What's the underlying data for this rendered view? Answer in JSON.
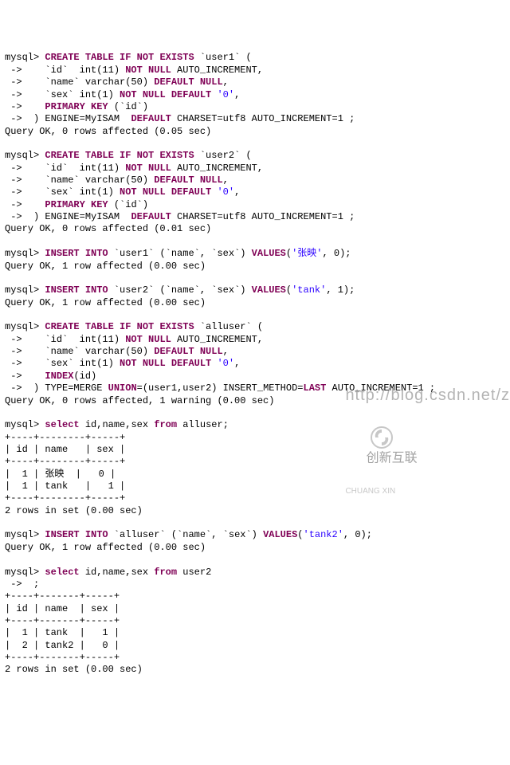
{
  "lines": [
    [
      {
        "t": "mysql> "
      },
      {
        "t": "CREATE TABLE IF NOT EXISTS",
        "cls": "kw"
      },
      {
        "t": " `user1` ("
      }
    ],
    [
      {
        "t": " -> "
      },
      {
        "t": "   `id`  int(11) "
      },
      {
        "t": "NOT NULL",
        "cls": "kw"
      },
      {
        "t": " AUTO_INCREMENT,"
      }
    ],
    [
      {
        "t": " -> "
      },
      {
        "t": "   `name` varchar(50) "
      },
      {
        "t": "DEFAULT NULL",
        "cls": "kw"
      },
      {
        "t": ","
      }
    ],
    [
      {
        "t": " -> "
      },
      {
        "t": "   `sex` int(1) "
      },
      {
        "t": "NOT NULL DEFAULT",
        "cls": "kw"
      },
      {
        "t": " "
      },
      {
        "t": "'0'",
        "cls": "str"
      },
      {
        "t": ","
      }
    ],
    [
      {
        "t": " -> "
      },
      {
        "t": "   "
      },
      {
        "t": "PRIMARY KEY",
        "cls": "kw"
      },
      {
        "t": " (`id`)"
      }
    ],
    [
      {
        "t": " -> "
      },
      {
        "t": " ) ENGINE=MyISAM  "
      },
      {
        "t": "DEFAULT",
        "cls": "kw"
      },
      {
        "t": " CHARSET=utf8 AUTO_INCREMENT=1 ;"
      }
    ],
    [
      {
        "t": "Query OK, 0 rows affected (0.05 sec)"
      }
    ],
    [
      {
        "t": " "
      }
    ],
    [
      {
        "t": "mysql> "
      },
      {
        "t": "CREATE TABLE IF NOT EXISTS",
        "cls": "kw"
      },
      {
        "t": " `user2` ("
      }
    ],
    [
      {
        "t": " -> "
      },
      {
        "t": "   `id`  int(11) "
      },
      {
        "t": "NOT NULL",
        "cls": "kw"
      },
      {
        "t": " AUTO_INCREMENT,"
      }
    ],
    [
      {
        "t": " -> "
      },
      {
        "t": "   `name` varchar(50) "
      },
      {
        "t": "DEFAULT NULL",
        "cls": "kw"
      },
      {
        "t": ","
      }
    ],
    [
      {
        "t": " -> "
      },
      {
        "t": "   `sex` int(1) "
      },
      {
        "t": "NOT NULL DEFAULT",
        "cls": "kw"
      },
      {
        "t": " "
      },
      {
        "t": "'0'",
        "cls": "str"
      },
      {
        "t": ","
      }
    ],
    [
      {
        "t": " -> "
      },
      {
        "t": "   "
      },
      {
        "t": "PRIMARY KEY",
        "cls": "kw"
      },
      {
        "t": " (`id`)"
      }
    ],
    [
      {
        "t": " -> "
      },
      {
        "t": " ) ENGINE=MyISAM  "
      },
      {
        "t": "DEFAULT",
        "cls": "kw"
      },
      {
        "t": " CHARSET=utf8 AUTO_INCREMENT=1 ;"
      }
    ],
    [
      {
        "t": "Query OK, 0 rows affected (0.01 sec)"
      }
    ],
    [
      {
        "t": " "
      }
    ],
    [
      {
        "t": "mysql> "
      },
      {
        "t": "INSERT INTO",
        "cls": "kw"
      },
      {
        "t": " `user1` (`name`, `sex`) "
      },
      {
        "t": "VALUES",
        "cls": "kw"
      },
      {
        "t": "("
      },
      {
        "t": "'张映'",
        "cls": "str"
      },
      {
        "t": ", 0);"
      }
    ],
    [
      {
        "t": "Query OK, 1 row affected (0.00 sec)"
      }
    ],
    [
      {
        "t": " "
      }
    ],
    [
      {
        "t": "mysql> "
      },
      {
        "t": "INSERT INTO",
        "cls": "kw"
      },
      {
        "t": " `user2` (`name`, `sex`) "
      },
      {
        "t": "VALUES",
        "cls": "kw"
      },
      {
        "t": "("
      },
      {
        "t": "'tank'",
        "cls": "str"
      },
      {
        "t": ", 1);"
      }
    ],
    [
      {
        "t": "Query OK, 1 row affected (0.00 sec)"
      }
    ],
    [
      {
        "t": " "
      }
    ],
    [
      {
        "t": "mysql> "
      },
      {
        "t": "CREATE TABLE IF NOT EXISTS",
        "cls": "kw"
      },
      {
        "t": " `alluser` ("
      }
    ],
    [
      {
        "t": " -> "
      },
      {
        "t": "   `id`  int(11) "
      },
      {
        "t": "NOT NULL",
        "cls": "kw"
      },
      {
        "t": " AUTO_INCREMENT,"
      }
    ],
    [
      {
        "t": " -> "
      },
      {
        "t": "   `name` varchar(50) "
      },
      {
        "t": "DEFAULT NULL",
        "cls": "kw"
      },
      {
        "t": ","
      }
    ],
    [
      {
        "t": " -> "
      },
      {
        "t": "   `sex` int(1) "
      },
      {
        "t": "NOT NULL DEFAULT",
        "cls": "kw"
      },
      {
        "t": " "
      },
      {
        "t": "'0'",
        "cls": "str"
      },
      {
        "t": ","
      }
    ],
    [
      {
        "t": " -> "
      },
      {
        "t": "   "
      },
      {
        "t": "INDEX",
        "cls": "kw"
      },
      {
        "t": "(id)"
      }
    ],
    [
      {
        "t": " -> "
      },
      {
        "t": " ) TYPE=MERGE "
      },
      {
        "t": "UNION",
        "cls": "kw"
      },
      {
        "t": "=(user1,user2) INSERT_METHOD="
      },
      {
        "t": "LAST",
        "cls": "kw"
      },
      {
        "t": " AUTO_INCREMENT=1 ;"
      }
    ],
    [
      {
        "t": "Query OK, 0 rows affected, 1 warning (0.00 sec)"
      }
    ],
    [
      {
        "t": " "
      }
    ],
    [
      {
        "t": "mysql> "
      },
      {
        "t": "select",
        "cls": "kw"
      },
      {
        "t": " id,name,sex "
      },
      {
        "t": "from",
        "cls": "kw"
      },
      {
        "t": " alluser;"
      }
    ],
    [
      {
        "t": "+----+--------+-----+"
      }
    ],
    [
      {
        "t": "| id | name   | sex |"
      }
    ],
    [
      {
        "t": "+----+--------+-----+"
      }
    ],
    [
      {
        "t": "|  1 | 张映  |   0 |"
      }
    ],
    [
      {
        "t": "|  1 | tank   |   1 |"
      }
    ],
    [
      {
        "t": "+----+--------+-----+"
      }
    ],
    [
      {
        "t": "2 rows in set (0.00 sec)"
      }
    ],
    [
      {
        "t": " "
      }
    ],
    [
      {
        "t": "mysql> "
      },
      {
        "t": "INSERT INTO",
        "cls": "kw"
      },
      {
        "t": " `alluser` (`name`, `sex`) "
      },
      {
        "t": "VALUES",
        "cls": "kw"
      },
      {
        "t": "("
      },
      {
        "t": "'tank2'",
        "cls": "str"
      },
      {
        "t": ", 0);"
      }
    ],
    [
      {
        "t": "Query OK, 1 row affected (0.00 sec)"
      }
    ],
    [
      {
        "t": " "
      }
    ],
    [
      {
        "t": "mysql> "
      },
      {
        "t": "select",
        "cls": "kw"
      },
      {
        "t": " id,name,sex "
      },
      {
        "t": "from",
        "cls": "kw"
      },
      {
        "t": " user2"
      }
    ],
    [
      {
        "t": " -> "
      },
      {
        "t": " ;"
      }
    ],
    [
      {
        "t": "+----+-------+-----+"
      }
    ],
    [
      {
        "t": "| id | name  | sex |"
      }
    ],
    [
      {
        "t": "+----+-------+-----+"
      }
    ],
    [
      {
        "t": "|  1 | tank  |   1 |"
      }
    ],
    [
      {
        "t": "|  2 | tank2 |   0 |"
      }
    ],
    [
      {
        "t": "+----+-------+-----+"
      }
    ],
    [
      {
        "t": "2 rows in set (0.00 sec)"
      }
    ]
  ],
  "watermark": {
    "url": "http://blog.csdn.net/z",
    "brand_cn": "创新互联",
    "brand_en": "CHUANG XIN"
  }
}
